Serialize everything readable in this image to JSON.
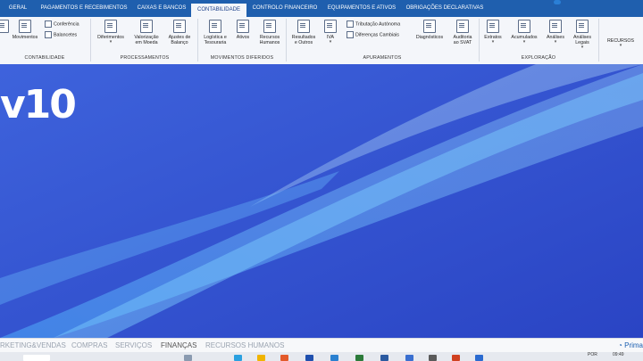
{
  "tabs": [
    {
      "label": "GERAL",
      "active": false
    },
    {
      "label": "PAGAMENTOS E RECEBIMENTOS",
      "active": false
    },
    {
      "label": "CAIXAS E BANCOS",
      "active": false
    },
    {
      "label": "CONTABILIDADE",
      "active": true
    },
    {
      "label": "CONTROLO FINANCEIRO",
      "active": false
    },
    {
      "label": "EQUIPAMENTOS E ATIVOS",
      "active": false
    },
    {
      "label": "OBRIGAÇÕES DECLARATIVAS",
      "active": false
    }
  ],
  "ribbon": {
    "contabilidade": {
      "label": "CONTABILIDADE",
      "movimentos": "Movimentos",
      "conferencia": "Conferência",
      "balancetes": "Balancetes"
    },
    "processamentos": {
      "label": "PROCESSAMENTOS",
      "diferimentos": "Diferimentos",
      "valorizacao_1": "Valorização",
      "valorizacao_2": "em Moeda",
      "ajustes_1": "Ajustes de",
      "ajustes_2": "Balanço"
    },
    "movimentos_diferidos": {
      "label": "MOVIMENTOS DIFERIDOS",
      "logistica_1": "Logística e",
      "logistica_2": "Tesouraria",
      "ativos": "Ativos",
      "recursos_1": "Recursos",
      "recursos_2": "Humanos"
    },
    "apuramentos": {
      "label": "APURAMENTOS",
      "resultados_1": "Resultados",
      "resultados_2": "e Outros",
      "iva": "IVA",
      "tributacao": "Tributação Autónoma",
      "diferencas": "Diferenças Cambiais",
      "diagnosticos": "Diagnósticos",
      "auditoria_1": "Auditoria",
      "auditoria_2": "ao SVAT"
    },
    "exploracao": {
      "label": "EXPLORAÇÃO",
      "extratos": "Extratos",
      "acumulados": "Acumulados",
      "analises": "Análises",
      "analises_legais_1": "Análises",
      "analises_legais_2": "Legais"
    },
    "recursos": "RECURSOS"
  },
  "logo_text": "v10",
  "bottom_nav": [
    {
      "label": "RKETING&VENDAS",
      "active": false
    },
    {
      "label": "COMPRAS",
      "active": false
    },
    {
      "label": "SERVIÇOS",
      "active": false
    },
    {
      "label": "FINANÇAS",
      "active": true
    },
    {
      "label": "RECURSOS HUMANOS",
      "active": false
    }
  ],
  "brand": "Prima",
  "taskbar": {
    "lang": "POR",
    "time": "09:49"
  },
  "colors": {
    "tabbar": "#1f5fae",
    "ribbon": "#f4f6fa",
    "background": "#2f4fd0",
    "accent": "#1b5fb0"
  }
}
